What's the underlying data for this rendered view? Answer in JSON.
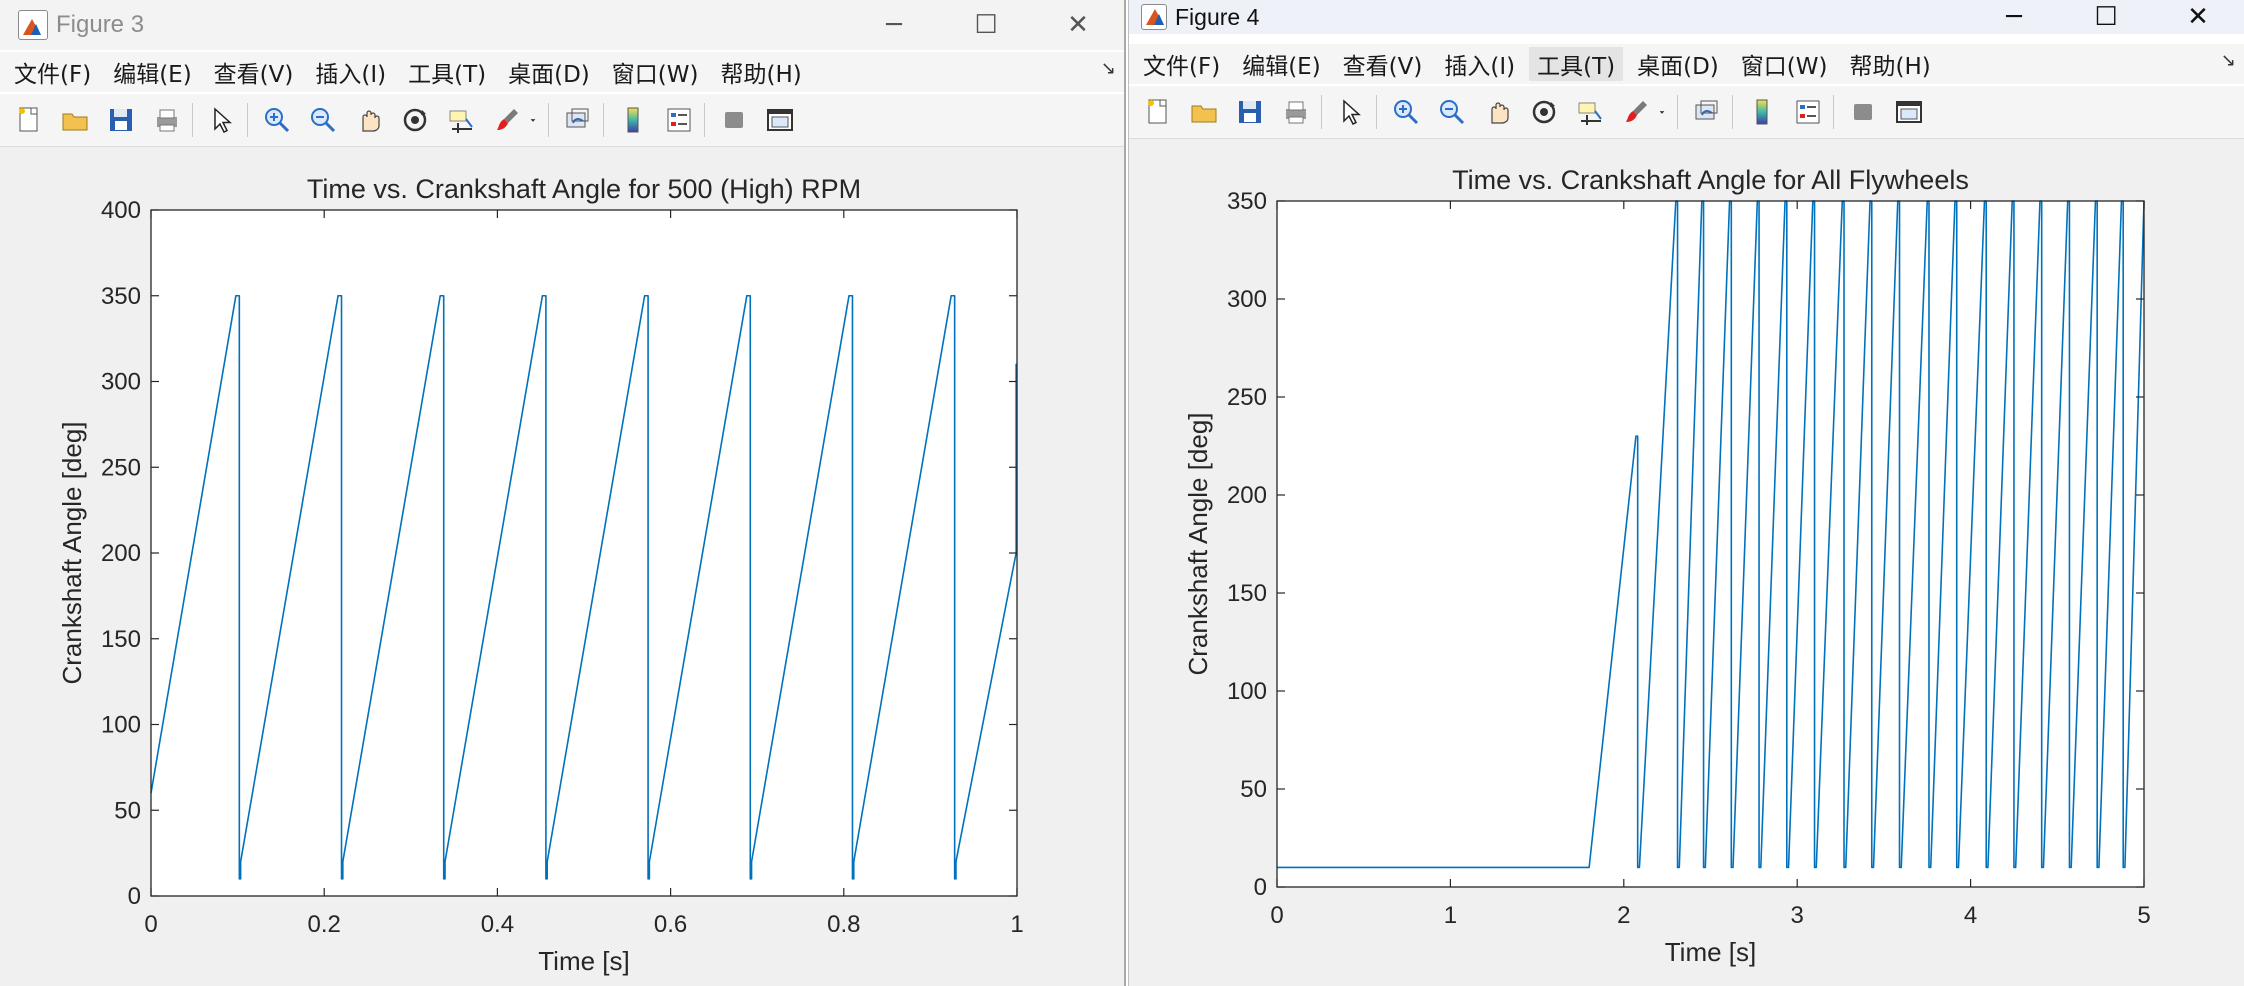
{
  "window1": {
    "title": "Figure 3",
    "controls": {
      "minimize": "─",
      "maximize": "☐",
      "close": "✕"
    },
    "menu": [
      "文件(F)",
      "编辑(E)",
      "查看(V)",
      "插入(I)",
      "工具(T)",
      "桌面(D)",
      "窗口(W)",
      "帮助(H)"
    ],
    "menu_dock": "↘"
  },
  "window2": {
    "title": "Figure 4",
    "controls": {
      "minimize": "─",
      "maximize": "☐",
      "close": "✕"
    },
    "menu": [
      "文件(F)",
      "编辑(E)",
      "查看(V)",
      "插入(I)",
      "工具(T)",
      "桌面(D)",
      "窗口(W)",
      "帮助(H)"
    ],
    "menu_dock": "↘"
  },
  "toolbar_icons": [
    "new-figure-icon",
    "open-file-icon",
    "save-icon",
    "print-icon",
    "sep",
    "edit-plot-arrow-icon",
    "sep",
    "zoom-in-icon",
    "zoom-out-icon",
    "pan-hand-icon",
    "rotate-3d-icon",
    "data-cursor-icon",
    "brush-icon",
    "brush-dropdown-icon",
    "sep",
    "link-plot-icon",
    "sep",
    "colorbar-icon",
    "legend-icon",
    "sep",
    "hide-plot-tools-icon",
    "show-plot-tools-icon"
  ],
  "colors": {
    "line": "#0072bd",
    "axes": "#262626"
  },
  "chart_data": [
    {
      "type": "line",
      "title": "Time vs. Crankshaft Angle for 500 (High) RPM",
      "xlabel": "Time [s]",
      "ylabel": "Crankshaft Angle [deg]",
      "xlim": [
        0,
        1
      ],
      "ylim": [
        0,
        400
      ],
      "xticks": [
        0,
        0.2,
        0.4,
        0.6,
        0.8,
        1
      ],
      "xtick_labels": [
        "0",
        "0.2",
        "0.4",
        "0.6",
        "0.8",
        "1"
      ],
      "yticks": [
        0,
        50,
        100,
        150,
        200,
        250,
        300,
        350,
        400
      ],
      "ytick_labels": [
        "0",
        "50",
        "100",
        "150",
        "200",
        "250",
        "300",
        "350",
        "400"
      ],
      "grid": false,
      "series": [
        {
          "x": [
            0,
            0.098,
            0.102,
            0.102,
            0.1035,
            0.1035,
            0.216,
            0.22,
            0.22,
            0.2215,
            0.2215,
            0.334,
            0.338,
            0.338,
            0.3395,
            0.3395,
            0.452,
            0.456,
            0.456,
            0.4575,
            0.4575,
            0.57,
            0.574,
            0.574,
            0.5755,
            0.5755,
            0.688,
            0.692,
            0.692,
            0.6935,
            0.6935,
            0.806,
            0.81,
            0.81,
            0.8115,
            0.8115,
            0.924,
            0.928,
            0.928,
            0.9295,
            0.9295,
            0.999,
            0.999,
            1.0
          ],
          "y": [
            60,
            350,
            350,
            10,
            10,
            20,
            350,
            350,
            10,
            10,
            20,
            350,
            350,
            10,
            10,
            20,
            350,
            350,
            10,
            10,
            20,
            350,
            350,
            10,
            10,
            20,
            350,
            350,
            10,
            10,
            20,
            350,
            350,
            10,
            10,
            20,
            350,
            350,
            10,
            10,
            20,
            200,
            310,
            310
          ]
        }
      ]
    },
    {
      "type": "line",
      "title": "Time vs. Crankshaft Angle for All Flywheels",
      "xlabel": "Time [s]",
      "ylabel": "Crankshaft Angle [deg]",
      "xlim": [
        0,
        5
      ],
      "ylim": [
        0,
        350
      ],
      "xticks": [
        0,
        1,
        2,
        3,
        4,
        5
      ],
      "xtick_labels": [
        "0",
        "1",
        "2",
        "3",
        "4",
        "5"
      ],
      "yticks": [
        0,
        50,
        100,
        150,
        200,
        250,
        300,
        350
      ],
      "ytick_labels": [
        "0",
        "50",
        "100",
        "150",
        "200",
        "250",
        "300",
        "350"
      ],
      "grid": false,
      "series": [
        {
          "x": [
            0,
            1.8,
            2.07,
            2.08,
            2.08,
            2.09,
            2.3,
            2.31,
            2.31,
            2.32,
            2.45,
            2.46,
            2.46,
            2.47,
            2.61,
            2.62,
            2.62,
            2.63,
            2.77,
            2.78,
            2.78,
            2.79,
            2.93,
            2.94,
            2.94,
            2.95,
            3.09,
            3.1,
            3.1,
            3.11,
            3.26,
            3.27,
            3.27,
            3.28,
            3.42,
            3.43,
            3.43,
            3.44,
            3.58,
            3.59,
            3.59,
            3.6,
            3.75,
            3.76,
            3.76,
            3.77,
            3.91,
            3.92,
            3.92,
            3.93,
            4.08,
            4.09,
            4.09,
            4.1,
            4.24,
            4.25,
            4.25,
            4.26,
            4.4,
            4.41,
            4.41,
            4.42,
            4.56,
            4.57,
            4.57,
            4.58,
            4.72,
            4.73,
            4.73,
            4.74,
            4.87,
            4.88,
            4.88,
            4.89,
            5.0
          ],
          "y": [
            10,
            10,
            230,
            230,
            10,
            10,
            350,
            350,
            10,
            10,
            350,
            350,
            10,
            10,
            350,
            350,
            10,
            10,
            350,
            350,
            10,
            10,
            350,
            350,
            10,
            10,
            350,
            350,
            10,
            10,
            350,
            350,
            10,
            10,
            350,
            350,
            10,
            10,
            350,
            350,
            10,
            10,
            350,
            350,
            10,
            10,
            350,
            350,
            10,
            10,
            350,
            350,
            10,
            10,
            350,
            350,
            10,
            10,
            350,
            350,
            10,
            10,
            350,
            350,
            10,
            10,
            350,
            350,
            10,
            10,
            350,
            350,
            10,
            10,
            350
          ]
        }
      ]
    }
  ]
}
